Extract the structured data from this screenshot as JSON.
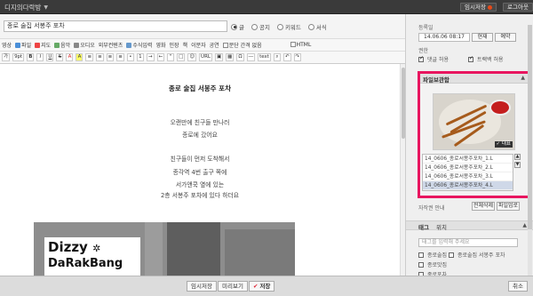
{
  "app": {
    "title": "디지의다락방",
    "temp_save_label": "임시저장",
    "logout_label": "로그아웃"
  },
  "post": {
    "title_value": "종로 술집 서봉주 포차",
    "title_placeholder": "",
    "category_options": [
      "글",
      "공지",
      "키워드",
      "서식"
    ],
    "category_selected": "글"
  },
  "toolbar": {
    "row1": [
      "영상",
      "파일",
      "지도",
      "음악",
      "오디오",
      "외부컨텐츠",
      "수식입력",
      "영화",
      "인장",
      "책",
      "이분자",
      "공연",
      "문단 간격 없음",
      "HTML"
    ],
    "row2_font": "가",
    "row2_size": "9pt",
    "url_label": "URL",
    "text_label": "text"
  },
  "editor": {
    "heading": "종로 술집 서봉주 포차",
    "lines": [
      "오랜만에 친구들 만나러",
      "종로에 갔어요",
      "",
      "친구들이 먼저 도착해서",
      "종각역 4번 출구 쪽에",
      "서가앤쿡 옆에 있는",
      "2층 서봉주 포차에 있다 하더요"
    ],
    "photo_text_line1": "Dizzy",
    "photo_text_line2": "DaRakBang",
    "photo_icon": "sparkle-icon"
  },
  "bottom": {
    "temp_save": "임시저장",
    "preview": "미리보기",
    "save": "저장",
    "cancel": "취소"
  },
  "sidebar": {
    "date_label": "등록일",
    "date_value": "14.06.06 08:17",
    "now_button": "현재",
    "reserve_button": "예약",
    "permission_label": "권한",
    "allow_comment": "댓글 허용",
    "allow_trackback": "트랙백 허용",
    "attach_title": "파일보관함",
    "thumb_badge": "대표",
    "files": [
      "14_0606_종로서봉주포차_1.L",
      "14_0606_종로서봉주포차_2.L",
      "14_0606_종로서봉주포차_3.L",
      "14_0606_종로서봉주포차_4.L"
    ],
    "attach_note": "자작권 안내",
    "delete_all": "전체삭제",
    "file_upload": "파일업로",
    "tag_tab": "태그",
    "location_tab": "위치",
    "tag_placeholder": "태그를 입력해 주세요",
    "tags": [
      "종로술집",
      "종로술집 서봉주 포차",
      "종로맛집",
      "종로포차"
    ]
  },
  "colors": {
    "highlight": "#e8155f",
    "topbar": "#3a3a3a",
    "temp_dot": "#e64a19"
  }
}
